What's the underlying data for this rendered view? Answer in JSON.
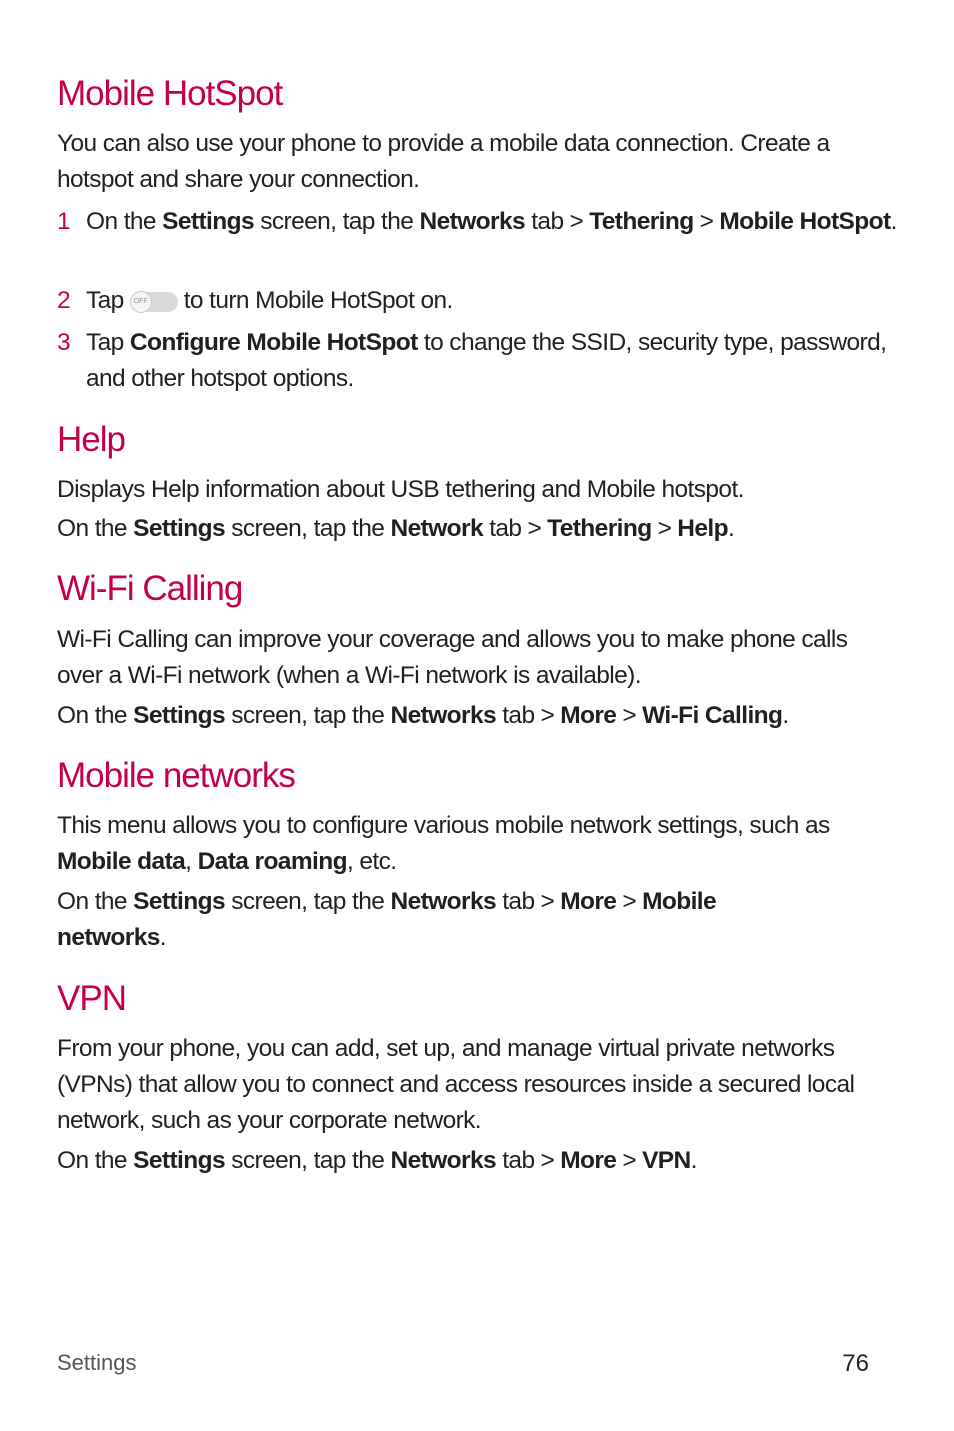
{
  "sections": {
    "hotspot": {
      "title": "Mobile HotSpot",
      "intro": "You can also use your phone to provide a mobile data connection. Create a hotspot and share your connection.",
      "steps": [
        {
          "num": "1",
          "t1": "On the ",
          "b1": "Settings",
          "t2": " screen, tap the ",
          "b2": "Networks",
          "t3": " tab",
          "b3": "Tethering",
          "b4": "Mobile HotSpot",
          "end": "."
        },
        {
          "num": "2",
          "t1": "Tap",
          "toggle_label": "OFF",
          "t2": "to turn Mobile HotSpot on."
        },
        {
          "num": "3",
          "t1": "Tap ",
          "b1": "Configure Mobile HotSpot",
          "t2": " to change the SSID, security type, password, and other hotspot options."
        }
      ]
    },
    "help": {
      "title": "Help",
      "desc": "Displays Help information about USB tethering and Mobile hotspot.",
      "path": {
        "t1": "On the ",
        "b1": "Settings",
        "t2": " screen, tap the ",
        "b2": "Network",
        "t3": " tab",
        "b3": "Tethering",
        "b4": "Help",
        "end": "."
      }
    },
    "wifi": {
      "title": "Wi-Fi Calling",
      "desc": "Wi-Fi Calling can improve your coverage and allows you to make phone calls over a Wi-Fi network (when a Wi-Fi network is available).",
      "path": {
        "t1": "On the ",
        "b1": "Settings",
        "t2": " screen, tap the ",
        "b2": "Networks",
        "t3": " tab",
        "b3": "More",
        "b4": "Wi-Fi Calling",
        "end": "."
      }
    },
    "mobile": {
      "title": "Mobile networks",
      "desc1": "This menu allows you to configure various mobile network settings, such as ",
      "b1": "Mobile data",
      "desc2": ", ",
      "b2": "Data roaming",
      "desc3": ", etc.",
      "path": {
        "t1": "On the ",
        "b1": "Settings",
        "t2": " screen, tap the ",
        "b2": "Networks",
        "t3": " tab",
        "b3": "More",
        "b4": "Mobile networks",
        "end": "."
      }
    },
    "vpn": {
      "title": "VPN",
      "desc": "From your phone, you can add, set up, and manage virtual private networks (VPNs) that allow you to connect and access resources inside a secured local network, such as your corporate network.",
      "path": {
        "t1": "On the ",
        "b1": "Settings",
        "t2": " screen, tap the ",
        "b2": "Networks",
        "t3": " tab",
        "b3": "More",
        "b4": "VPN",
        "end": "."
      }
    }
  },
  "separator": ">",
  "footer": {
    "section": "Settings",
    "page": "76"
  }
}
